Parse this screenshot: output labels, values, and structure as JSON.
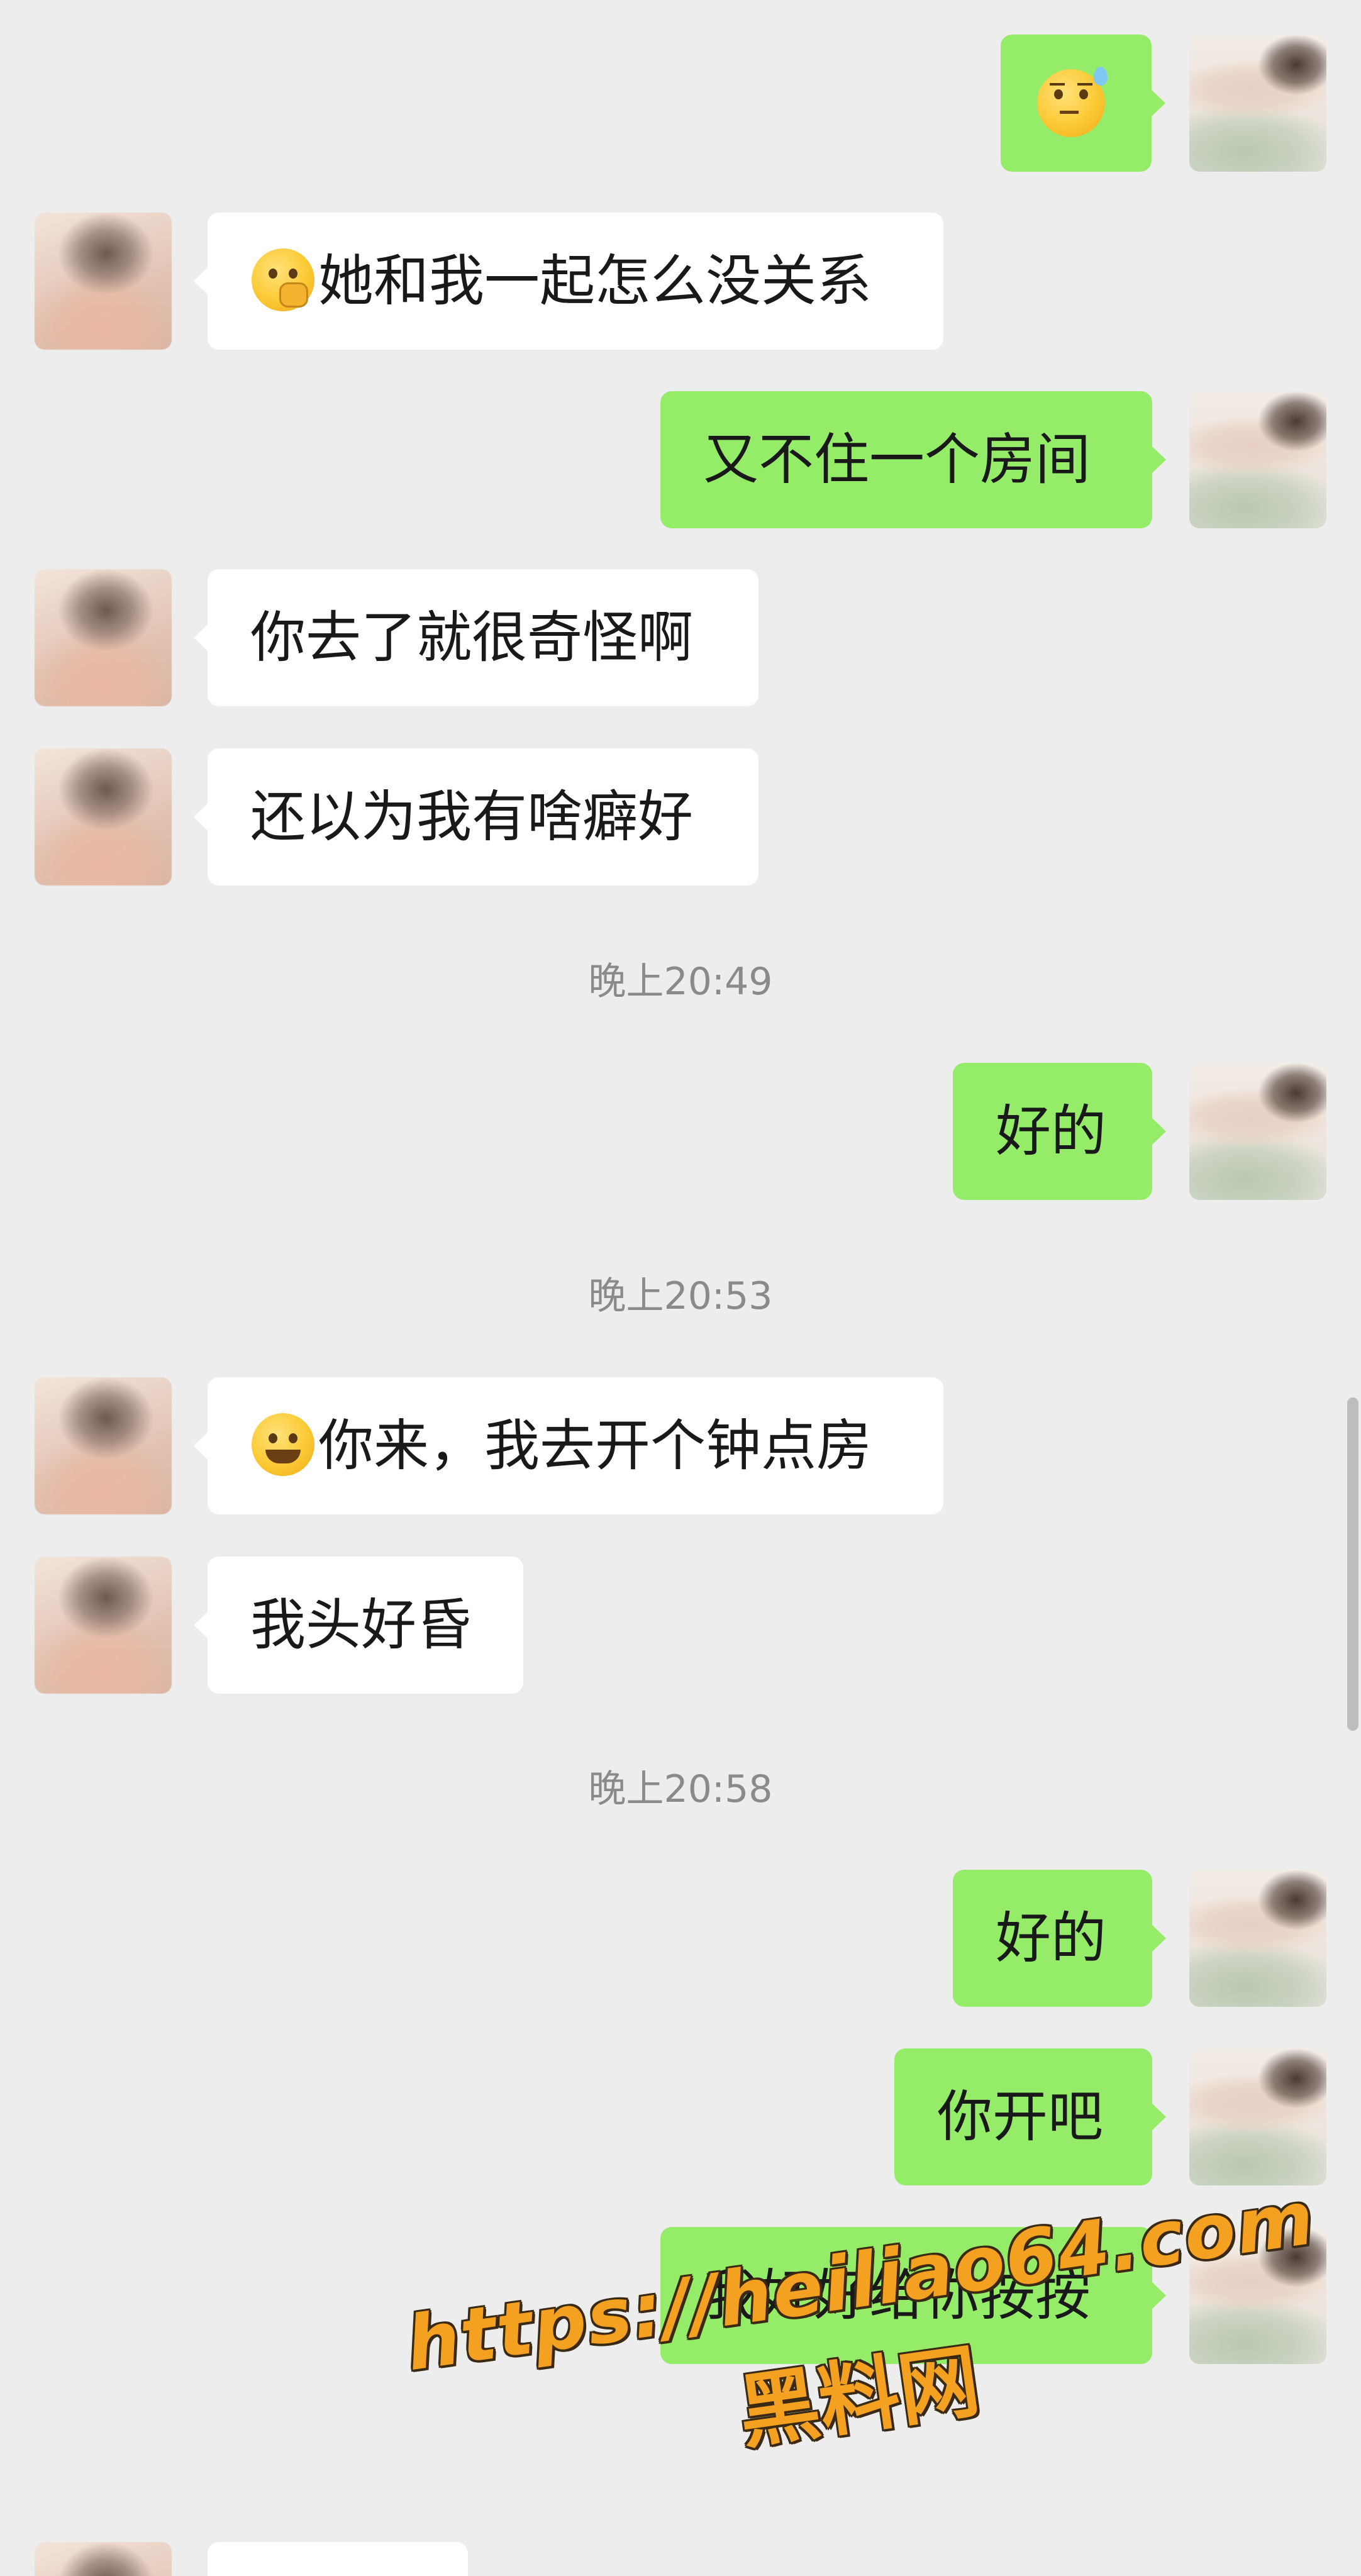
{
  "messages": [
    {
      "sender": "me",
      "emoji": "sweat-unamused-face-emoji",
      "text": ""
    },
    {
      "sender": "friend",
      "emoji": "hand-over-mouth-face-emoji",
      "text": "她和我一起怎么没关系"
    },
    {
      "sender": "me",
      "text": "又不住一个房间"
    },
    {
      "sender": "friend",
      "text": "你去了就很奇怪啊"
    },
    {
      "sender": "friend",
      "text": "还以为我有啥癖好"
    },
    {
      "sender": "time",
      "text": "晚上20:49"
    },
    {
      "sender": "me",
      "text": "好的"
    },
    {
      "sender": "time",
      "text": "晚上20:53"
    },
    {
      "sender": "friend",
      "emoji": "grinning-face-emoji",
      "text": "你来，我去开个钟点房"
    },
    {
      "sender": "friend",
      "text": "我头好昏"
    },
    {
      "sender": "time",
      "text": "晚上20:58"
    },
    {
      "sender": "me",
      "text": "好的"
    },
    {
      "sender": "me",
      "text": "你开吧"
    },
    {
      "sender": "me",
      "text": "我好好给你按按"
    }
  ],
  "watermark": {
    "url": "https://heiliao64.com",
    "name": "黑料网"
  },
  "colors": {
    "background": "#ededed",
    "my_bubble": "#95ec69",
    "friend_bubble": "#ffffff",
    "timestamp": "#8a8a8a",
    "watermark": "#f4a020"
  }
}
